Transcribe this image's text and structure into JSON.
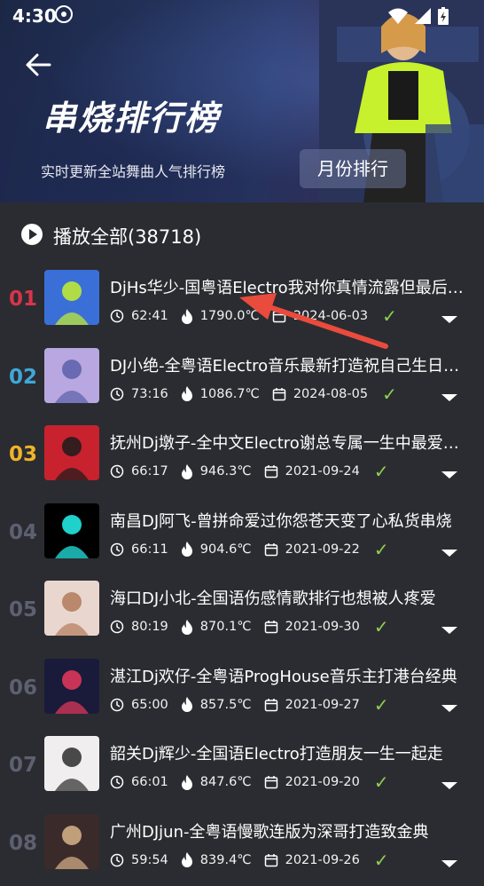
{
  "status_bar": {
    "time": "4:30"
  },
  "header": {
    "title": "串烧排行榜",
    "subtitle": "实时更新全站舞曲人气排行榜",
    "month_button": "月份排行"
  },
  "play_all": {
    "label": "播放全部(38718)"
  },
  "colors": {
    "rank_1": "#d8344a",
    "rank_2": "#3ea8d8",
    "rank_3": "#f0b429",
    "rank_other": "#5d6070",
    "check": "#8fd14f"
  },
  "songs": [
    {
      "rank": "01",
      "title": "DjHs华少-国粤语Electro我对你真情流露但最后…",
      "duration": "62:41",
      "heat": "1790.0℃",
      "date": "2024-06-03"
    },
    {
      "rank": "02",
      "title": "DJ小绝-全粤语Electro音乐最新打造祝自己生日快乐",
      "duration": "73:16",
      "heat": "1086.7℃",
      "date": "2024-08-05"
    },
    {
      "rank": "03",
      "title": "抚州Dj墩子-全中文Electro谢总专属一生中最爱的人",
      "duration": "66:17",
      "heat": "946.3℃",
      "date": "2021-09-24"
    },
    {
      "rank": "04",
      "title": "南昌DJ阿飞-曾拼命爱过你怨苍天变了心私货串烧",
      "duration": "66:11",
      "heat": "904.6℃",
      "date": "2021-09-22"
    },
    {
      "rank": "05",
      "title": "海口DJ小北-全国语伤感情歌排行也想被人疼爱",
      "duration": "80:19",
      "heat": "870.1℃",
      "date": "2021-09-30"
    },
    {
      "rank": "06",
      "title": "湛江Dj欢仔-全粤语ProgHouse音乐主打港台经典",
      "duration": "65:00",
      "heat": "857.5℃",
      "date": "2021-09-27"
    },
    {
      "rank": "07",
      "title": "韶关Dj辉少-全国语Electro打造朋友一生一起走",
      "duration": "66:01",
      "heat": "847.6℃",
      "date": "2021-09-20"
    },
    {
      "rank": "08",
      "title": "广州DJjun-全粤语慢歌连版为深哥打造致金典",
      "duration": "59:54",
      "heat": "839.4℃",
      "date": "2021-09-26"
    }
  ]
}
